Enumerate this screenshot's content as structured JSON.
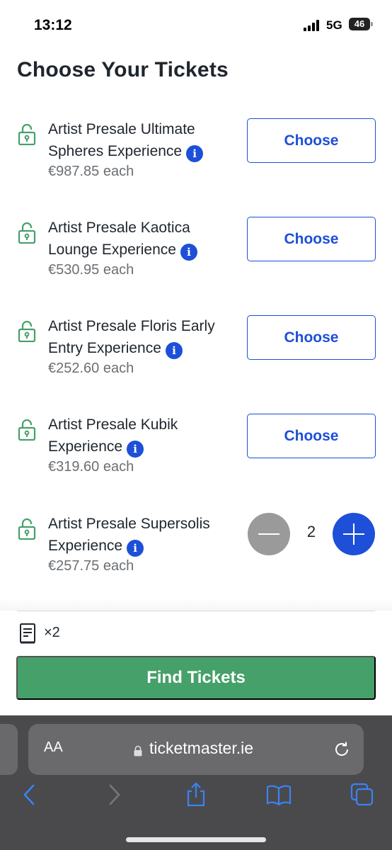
{
  "status_bar": {
    "time": "13:12",
    "network": "5G",
    "battery": "46"
  },
  "page_title": "Choose Your Tickets",
  "tickets": [
    {
      "name": "Artist Presale Ultimate Spheres Experience",
      "price": "€987.85 each",
      "action": "Choose"
    },
    {
      "name": "Artist Presale Kaotica Lounge Experience",
      "price": "€530.95 each",
      "action": "Choose"
    },
    {
      "name": "Artist Presale Floris Early Entry Experience",
      "price": "€252.60 each",
      "action": "Choose"
    },
    {
      "name": "Artist Presale Kubik Experience",
      "price": "€319.60 each",
      "action": "Choose"
    },
    {
      "name": "Artist Presale Supersolis Experience",
      "price": "€257.75 each",
      "quantity": "2"
    }
  ],
  "footer": {
    "ticket_count": "×2",
    "find_button": "Find Tickets"
  },
  "browser": {
    "text_size_label": "AA",
    "url": "ticketmaster.ie"
  },
  "colors": {
    "accent_blue": "#1d4fd8",
    "lock_green": "#46a069",
    "find_button_green": "#46a069"
  }
}
